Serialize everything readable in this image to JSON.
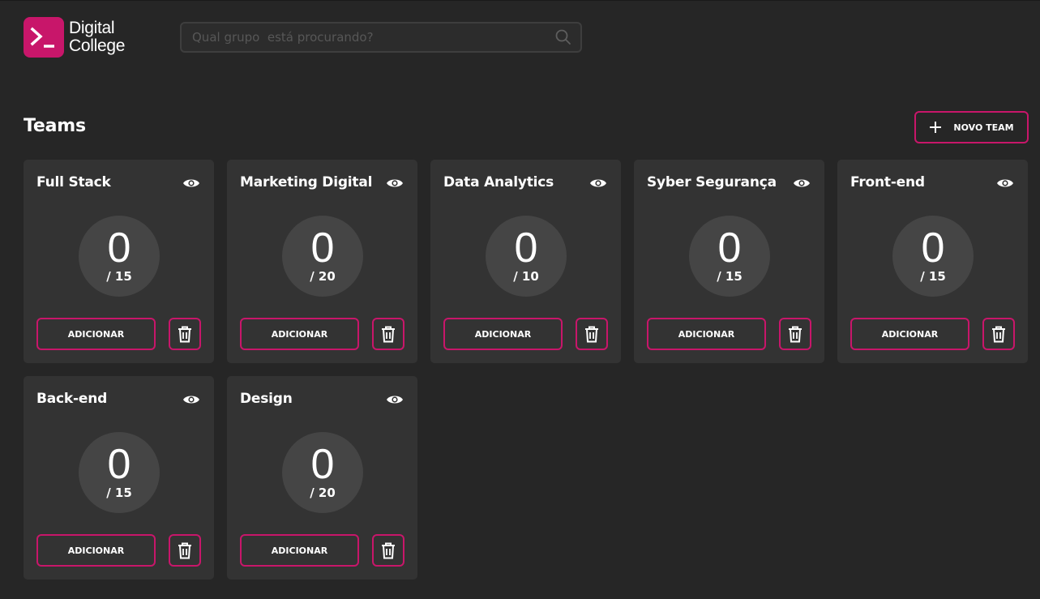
{
  "brand": {
    "logo_icon": "terminal-prompt-icon",
    "name_line1": "Digital",
    "name_line2": "College",
    "accent_color": "#c8166a"
  },
  "search": {
    "placeholder": "Qual grupo  está procurando?",
    "value": "",
    "icon": "search-icon"
  },
  "section": {
    "title": "Teams",
    "new_team_label": "NOVO TEAM",
    "new_team_icon": "plus-icon"
  },
  "teams": [
    {
      "name": "Full Stack",
      "count": "0",
      "max": "/ 15",
      "add_label": "ADICIONAR"
    },
    {
      "name": "Marketing Digital",
      "count": "0",
      "max": "/ 20",
      "add_label": "ADICIONAR"
    },
    {
      "name": "Data Analytics",
      "count": "0",
      "max": "/ 10",
      "add_label": "ADICIONAR"
    },
    {
      "name": "Syber Segurança",
      "count": "0",
      "max": "/ 15",
      "add_label": "ADICIONAR"
    },
    {
      "name": "Front-end",
      "count": "0",
      "max": "/ 15",
      "add_label": "ADICIONAR"
    },
    {
      "name": "Back-end",
      "count": "0",
      "max": "/ 15",
      "add_label": "ADICIONAR"
    },
    {
      "name": "Design",
      "count": "0",
      "max": "/ 20",
      "add_label": "ADICIONAR"
    }
  ]
}
